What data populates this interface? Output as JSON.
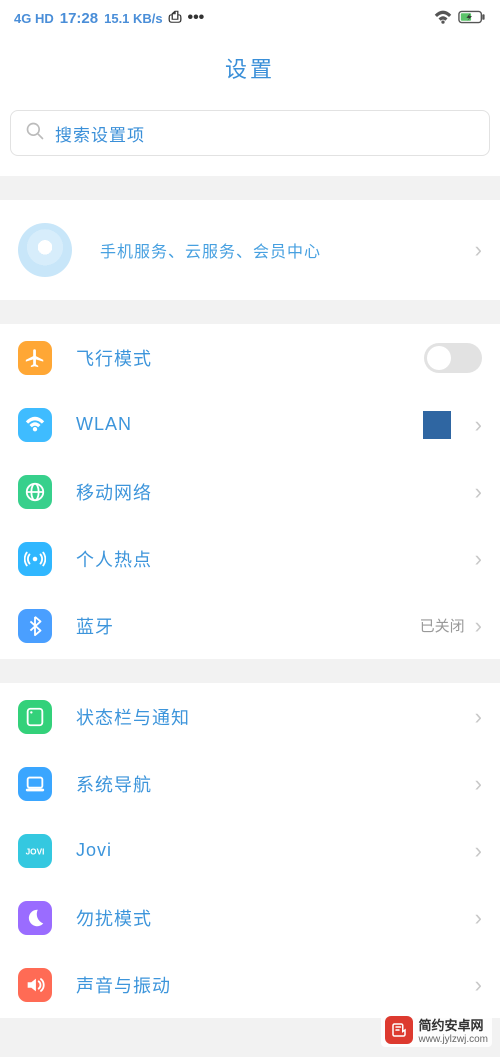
{
  "status": {
    "net": "4G HD",
    "time": "17:28",
    "speed": "15.1 KB/s"
  },
  "title": "设置",
  "search": {
    "placeholder": "搜索设置项"
  },
  "account": {
    "label": "手机服务、云服务、会员中心"
  },
  "groups": {
    "g1": {
      "airplane": {
        "label": "飞行模式"
      },
      "wlan": {
        "label": "WLAN"
      },
      "mobilenet": {
        "label": "移动网络"
      },
      "hotspot": {
        "label": "个人热点"
      },
      "bluetooth": {
        "label": "蓝牙",
        "value": "已关闭"
      }
    },
    "g2": {
      "statusbar": {
        "label": "状态栏与通知"
      },
      "sysnav": {
        "label": "系统导航"
      },
      "jovi": {
        "label": "Jovi"
      },
      "dnd": {
        "label": "勿扰模式"
      },
      "sound": {
        "label": "声音与振动"
      }
    }
  },
  "watermark": {
    "cn": "简约安卓网",
    "url": "www.jylzwj.com"
  },
  "icon_colors": {
    "airplane": "#ffa735",
    "wifi": "#3fbcff",
    "globe": "#37d08c",
    "hotspot": "#30b7ff",
    "bt": "#4a9fff",
    "status": "#33d17a",
    "nav": "#3aa6ff",
    "jovi": "#34c8e0",
    "dnd": "#9a6cff",
    "sound": "#ff6b55"
  }
}
